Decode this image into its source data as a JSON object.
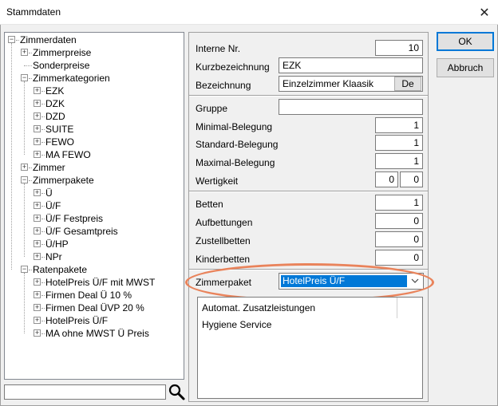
{
  "window": {
    "title": "Stammdaten",
    "close_glyph": "✕"
  },
  "tree": {
    "items": [
      {
        "label": "Zimmerdaten",
        "level": 0,
        "expander": "−"
      },
      {
        "label": "Zimmerpreise",
        "level": 1,
        "expander": "+"
      },
      {
        "label": "Sonderpreise",
        "level": 1,
        "expander": ""
      },
      {
        "label": "Zimmerkategorien",
        "level": 1,
        "expander": "−"
      },
      {
        "label": "EZK",
        "level": 2,
        "expander": "+"
      },
      {
        "label": "DZK",
        "level": 2,
        "expander": "+"
      },
      {
        "label": "DZD",
        "level": 2,
        "expander": "+"
      },
      {
        "label": "SUITE",
        "level": 2,
        "expander": "+"
      },
      {
        "label": "FEWO",
        "level": 2,
        "expander": "+"
      },
      {
        "label": "MA FEWO",
        "level": 2,
        "expander": "+"
      },
      {
        "label": "Zimmer",
        "level": 1,
        "expander": "+"
      },
      {
        "label": "Zimmerpakete",
        "level": 1,
        "expander": "−"
      },
      {
        "label": "Ü",
        "level": 2,
        "expander": "+"
      },
      {
        "label": "Ü/F",
        "level": 2,
        "expander": "+"
      },
      {
        "label": "Ü/F Festpreis",
        "level": 2,
        "expander": "+"
      },
      {
        "label": "Ü/F Gesamtpreis",
        "level": 2,
        "expander": "+"
      },
      {
        "label": "Ü/HP",
        "level": 2,
        "expander": "+"
      },
      {
        "label": "NPr",
        "level": 2,
        "expander": "+"
      },
      {
        "label": "Ratenpakete",
        "level": 1,
        "expander": "−"
      },
      {
        "label": "HotelPreis Ü/F mit MWST",
        "level": 2,
        "expander": "+"
      },
      {
        "label": "Firmen Deal  Ü 10 %",
        "level": 2,
        "expander": "+"
      },
      {
        "label": "Firmen Deal  ÜVP 20 %",
        "level": 2,
        "expander": "+"
      },
      {
        "label": "HotelPreis Ü/F",
        "level": 2,
        "expander": "+"
      },
      {
        "label": "MA ohne MWST Ü Preis",
        "level": 2,
        "expander": "+"
      }
    ]
  },
  "search": {
    "value": "",
    "placeholder": ""
  },
  "form": {
    "interne_nr": {
      "label": "Interne Nr.",
      "value": "10"
    },
    "kurzbezeichnung": {
      "label": "Kurzbezeichnung",
      "value": "EZK"
    },
    "bezeichnung": {
      "label": "Bezeichnung",
      "value": "Einzelzimmer Klaasik",
      "lang_button": "De"
    },
    "gruppe": {
      "label": "Gruppe",
      "value": ""
    },
    "minimal": {
      "label": "Minimal-Belegung",
      "value": "1"
    },
    "standard": {
      "label": "Standard-Belegung",
      "value": "1"
    },
    "maximal": {
      "label": "Maximal-Belegung",
      "value": "1"
    },
    "wertigkeit": {
      "label": "Wertigkeit",
      "value1": "0",
      "value2": "0"
    },
    "betten": {
      "label": "Betten",
      "value": "1"
    },
    "aufbettungen": {
      "label": "Aufbettungen",
      "value": "0"
    },
    "zustellbetten": {
      "label": "Zustellbetten",
      "value": "0"
    },
    "kinderbetten": {
      "label": "Kinderbetten",
      "value": "0"
    },
    "zimmerpaket": {
      "label": "Zimmerpaket",
      "value": "HotelPreis Ü/F"
    }
  },
  "extras": {
    "items": [
      "Automat. Zusatzleistungen",
      "Hygiene Service"
    ]
  },
  "buttons": {
    "ok": "OK",
    "abbruch": "Abbruch"
  },
  "colors": {
    "selection": "#0078d7",
    "highlight": "#e9835b"
  }
}
